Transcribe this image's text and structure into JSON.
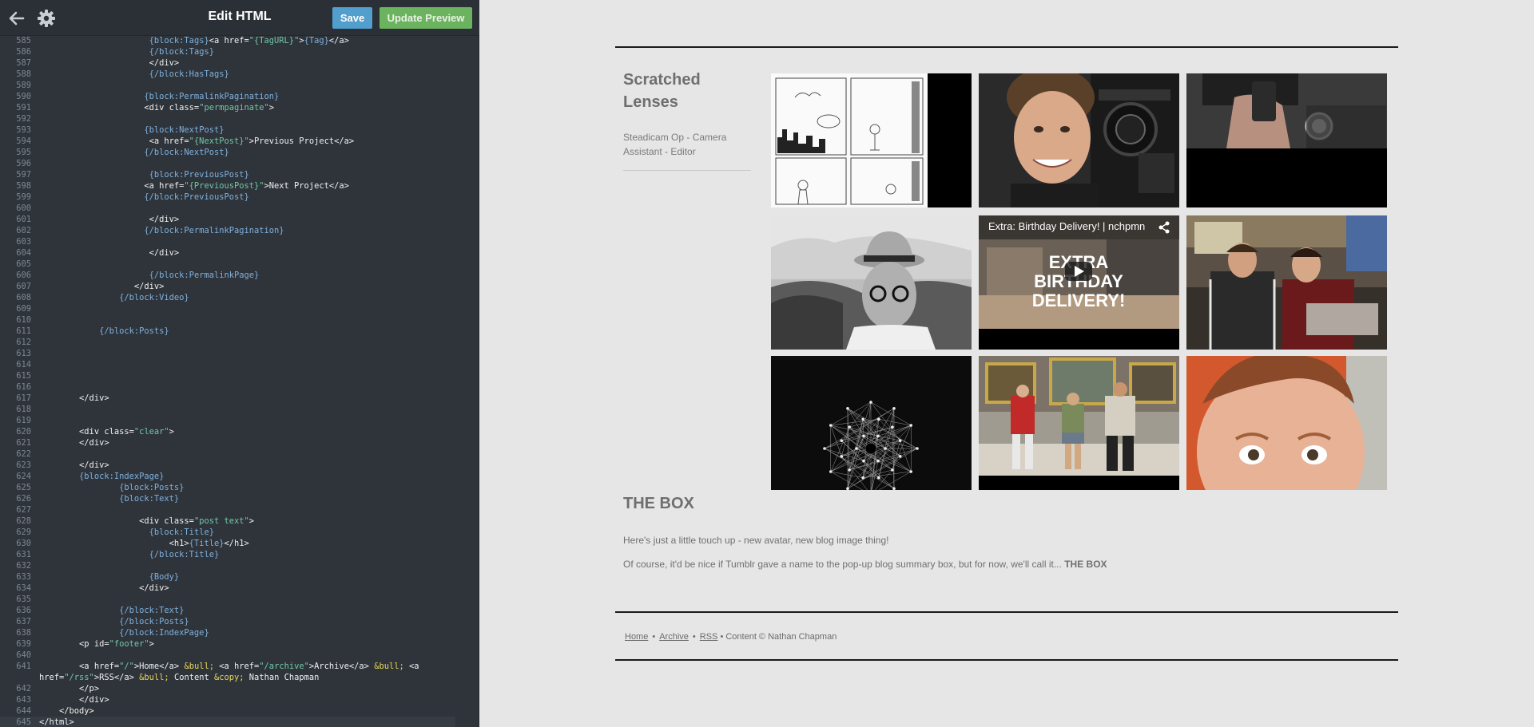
{
  "editor": {
    "title": "Edit HTML",
    "save_label": "Save",
    "preview_label": "Update Preview",
    "icons": {
      "back": "arrow-left-icon",
      "settings": "gear-icon"
    },
    "lines": [
      {
        "n": "585",
        "html": "                      <span class='t-blk'>{block:Tags}</span>&lt;a href=<span class='t-str'>\"{TagURL}\"</span>&gt;<span class='t-blk'>{Tag}</span>&lt;/a&gt;"
      },
      {
        "n": "586",
        "html": "                      <span class='t-blk'>{/block:Tags}</span>"
      },
      {
        "n": "587",
        "html": "                      &lt;/div&gt;"
      },
      {
        "n": "588",
        "html": "                      <span class='t-blk'>{/block:HasTags}</span>"
      },
      {
        "n": "589",
        "html": ""
      },
      {
        "n": "590",
        "html": "                     <span class='t-blk'>{block:PermalinkPagination}</span>"
      },
      {
        "n": "591",
        "html": "                     &lt;div class=<span class='t-str'>\"permpaginate\"</span>&gt;"
      },
      {
        "n": "592",
        "html": ""
      },
      {
        "n": "593",
        "html": "                     <span class='t-blk'>{block:NextPost}</span>"
      },
      {
        "n": "594",
        "html": "                      &lt;a href=<span class='t-str'>\"{NextPost}\"</span>&gt;Previous Project&lt;/a&gt;"
      },
      {
        "n": "595",
        "html": "                     <span class='t-blk'>{/block:NextPost}</span>"
      },
      {
        "n": "596",
        "html": ""
      },
      {
        "n": "597",
        "html": "                      <span class='t-blk'>{block:PreviousPost}</span>"
      },
      {
        "n": "598",
        "html": "                     &lt;a href=<span class='t-str'>\"{PreviousPost}\"</span>&gt;Next Project&lt;/a&gt;"
      },
      {
        "n": "599",
        "html": "                     <span class='t-blk'>{/block:PreviousPost}</span>"
      },
      {
        "n": "600",
        "html": ""
      },
      {
        "n": "601",
        "html": "                      &lt;/div&gt;"
      },
      {
        "n": "602",
        "html": "                     <span class='t-blk'>{/block:PermalinkPagination}</span>"
      },
      {
        "n": "603",
        "html": ""
      },
      {
        "n": "604",
        "html": "                      &lt;/div&gt;"
      },
      {
        "n": "605",
        "html": ""
      },
      {
        "n": "606",
        "html": "                      <span class='t-blk'>{/block:PermalinkPage}</span>"
      },
      {
        "n": "607",
        "html": "                   &lt;/div&gt;"
      },
      {
        "n": "608",
        "html": "                <span class='t-blk'>{/block:Video}</span>"
      },
      {
        "n": "609",
        "html": ""
      },
      {
        "n": "610",
        "html": ""
      },
      {
        "n": "611",
        "html": "            <span class='t-blk'>{/block:Posts}</span>"
      },
      {
        "n": "612",
        "html": ""
      },
      {
        "n": "613",
        "html": ""
      },
      {
        "n": "614",
        "html": ""
      },
      {
        "n": "615",
        "html": ""
      },
      {
        "n": "616",
        "html": ""
      },
      {
        "n": "617",
        "html": "        &lt;/div&gt;"
      },
      {
        "n": "618",
        "html": ""
      },
      {
        "n": "619",
        "html": ""
      },
      {
        "n": "620",
        "html": "        &lt;div class=<span class='t-str'>\"clear\"</span>&gt;"
      },
      {
        "n": "621",
        "html": "        &lt;/div&gt;"
      },
      {
        "n": "622",
        "html": ""
      },
      {
        "n": "623",
        "html": "        &lt;/div&gt;"
      },
      {
        "n": "624",
        "html": "        <span class='t-blk'>{block:IndexPage}</span>"
      },
      {
        "n": "625",
        "html": "                <span class='t-blk'>{block:Posts}</span>"
      },
      {
        "n": "626",
        "html": "                <span class='t-blk'>{block:Text}</span>"
      },
      {
        "n": "627",
        "html": ""
      },
      {
        "n": "628",
        "html": "                    &lt;div class=<span class='t-str'>\"post text\"</span>&gt;"
      },
      {
        "n": "629",
        "html": "                      <span class='t-blk'>{block:Title}</span>"
      },
      {
        "n": "630",
        "html": "                          &lt;h1&gt;<span class='t-blk'>{Title}</span>&lt;/h1&gt;"
      },
      {
        "n": "631",
        "html": "                      <span class='t-blk'>{/block:Title}</span>"
      },
      {
        "n": "632",
        "html": ""
      },
      {
        "n": "633",
        "html": "                      <span class='t-blk'>{Body}</span>"
      },
      {
        "n": "634",
        "html": "                    &lt;/div&gt;"
      },
      {
        "n": "635",
        "html": ""
      },
      {
        "n": "636",
        "html": "                <span class='t-blk'>{/block:Text}</span>"
      },
      {
        "n": "637",
        "html": "                <span class='t-blk'>{/block:Posts}</span>"
      },
      {
        "n": "638",
        "html": "                <span class='t-blk'>{/block:IndexPage}</span>"
      },
      {
        "n": "639",
        "html": "        &lt;p id=<span class='t-str'>\"footer\"</span>&gt;"
      },
      {
        "n": "640",
        "html": ""
      },
      {
        "n": "641",
        "html": "        &lt;a href=<span class='t-str'>\"/\"</span>&gt;Home&lt;/a&gt; <span class='t-ent'>&amp;bull;</span> &lt;a href=<span class='t-str'>\"/archive\"</span>&gt;Archive&lt;/a&gt; <span class='t-ent'>&amp;bull;</span> &lt;a"
      },
      {
        "n": "",
        "html": "href=<span class='t-str'>\"/rss\"</span>&gt;RSS&lt;/a&gt; <span class='t-ent'>&amp;bull;</span> Content <span class='t-ent'>&amp;copy;</span> Nathan Chapman"
      },
      {
        "n": "642",
        "html": "        &lt;/p&gt;"
      },
      {
        "n": "643",
        "html": "        &lt;/div&gt;"
      },
      {
        "n": "644",
        "html": "    &lt;/body&gt;"
      },
      {
        "n": "645",
        "html": "&lt;/html&gt;"
      }
    ]
  },
  "preview": {
    "blog_title": "Scratched Lenses",
    "blog_description": "Steadicam Op - Camera Assistant - Editor",
    "thumbnails": [
      {
        "name": "comic-thumbnail",
        "kind": "comic"
      },
      {
        "name": "camera-operator-thumbnail",
        "kind": "portrait"
      },
      {
        "name": "watch-hand-thumbnail",
        "kind": "hand"
      },
      {
        "name": "man-in-hat-thumbnail",
        "kind": "bw"
      },
      {
        "name": "birthday-delivery-video-thumbnail",
        "kind": "video",
        "video_title": "Extra: Birthday Delivery! | nchpmn",
        "video_text_1": "EXTRA",
        "video_text_2": "BIRTHDAY",
        "video_text_3": "DELIVERY!"
      },
      {
        "name": "train-couple-thumbnail",
        "kind": "train"
      },
      {
        "name": "network-graph-thumbnail",
        "kind": "network"
      },
      {
        "name": "museum-scene-thumbnail",
        "kind": "museum"
      },
      {
        "name": "face-closeup-thumbnail",
        "kind": "face"
      }
    ],
    "post_title": "THE BOX",
    "post_p1": "Here's just a little touch up - new avatar, new blog image thing!",
    "post_p2": "Of course, it'd be nice if Tumblr gave a name to the pop-up blog summary box, but for now, we'll call it...",
    "post_p2_bold": "THE BOX",
    "footer": {
      "home": "Home",
      "archive": "Archive",
      "rss": "RSS",
      "bullet": "•",
      "content": "• Content © Nathan Chapman"
    }
  }
}
